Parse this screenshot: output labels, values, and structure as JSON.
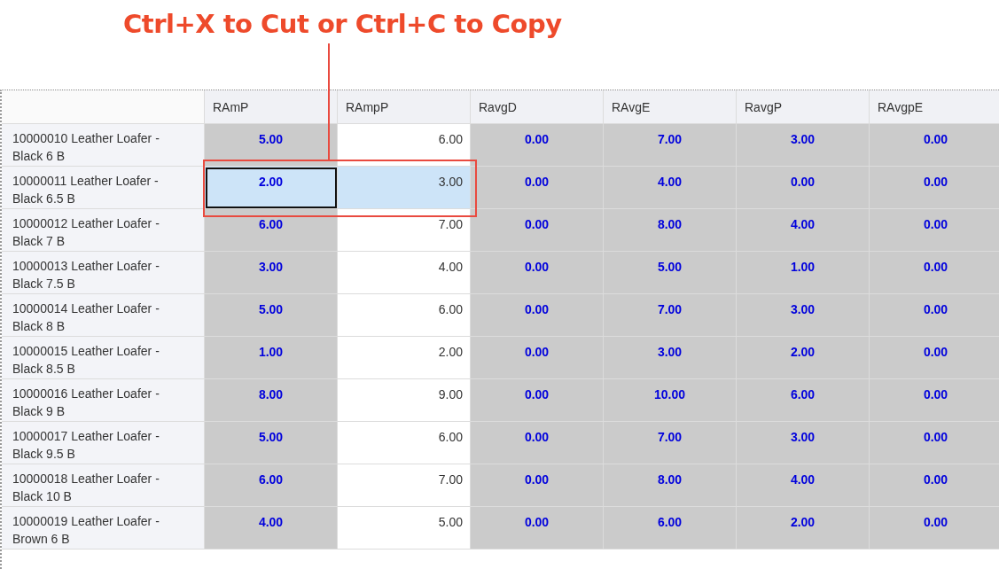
{
  "callout": {
    "text": "Ctrl+X to Cut or Ctrl+C to Copy"
  },
  "table": {
    "columns": [
      {
        "label": "RAmP",
        "kind": "computed"
      },
      {
        "label": "RAmpP",
        "kind": "editable"
      },
      {
        "label": "RavgD",
        "kind": "computed"
      },
      {
        "label": "RAvgE",
        "kind": "computed"
      },
      {
        "label": "RavgP",
        "kind": "computed"
      },
      {
        "label": "RAvgpE",
        "kind": "computed"
      }
    ],
    "rows": [
      {
        "label": "10000010 Leather Loafer - Black 6 B",
        "cells": [
          {
            "value": "5.00",
            "selected": false,
            "focused": false
          },
          {
            "value": "6.00",
            "selected": false,
            "focused": false
          },
          {
            "value": "0.00",
            "selected": false,
            "focused": false
          },
          {
            "value": "7.00",
            "selected": false,
            "focused": false
          },
          {
            "value": "3.00",
            "selected": false,
            "focused": false
          },
          {
            "value": "0.00",
            "selected": false,
            "focused": false
          }
        ]
      },
      {
        "label": "10000011 Leather Loafer - Black 6.5 B",
        "cells": [
          {
            "value": "2.00",
            "selected": true,
            "focused": true
          },
          {
            "value": "3.00",
            "selected": true,
            "focused": false
          },
          {
            "value": "0.00",
            "selected": false,
            "focused": false
          },
          {
            "value": "4.00",
            "selected": false,
            "focused": false
          },
          {
            "value": "0.00",
            "selected": false,
            "focused": false
          },
          {
            "value": "0.00",
            "selected": false,
            "focused": false
          }
        ]
      },
      {
        "label": "10000012 Leather Loafer - Black 7 B",
        "cells": [
          {
            "value": "6.00",
            "selected": false,
            "focused": false
          },
          {
            "value": "7.00",
            "selected": false,
            "focused": false
          },
          {
            "value": "0.00",
            "selected": false,
            "focused": false
          },
          {
            "value": "8.00",
            "selected": false,
            "focused": false
          },
          {
            "value": "4.00",
            "selected": false,
            "focused": false
          },
          {
            "value": "0.00",
            "selected": false,
            "focused": false
          }
        ]
      },
      {
        "label": "10000013 Leather Loafer - Black 7.5 B",
        "cells": [
          {
            "value": "3.00",
            "selected": false,
            "focused": false
          },
          {
            "value": "4.00",
            "selected": false,
            "focused": false
          },
          {
            "value": "0.00",
            "selected": false,
            "focused": false
          },
          {
            "value": "5.00",
            "selected": false,
            "focused": false
          },
          {
            "value": "1.00",
            "selected": false,
            "focused": false
          },
          {
            "value": "0.00",
            "selected": false,
            "focused": false
          }
        ]
      },
      {
        "label": "10000014 Leather Loafer - Black 8 B",
        "cells": [
          {
            "value": "5.00",
            "selected": false,
            "focused": false
          },
          {
            "value": "6.00",
            "selected": false,
            "focused": false
          },
          {
            "value": "0.00",
            "selected": false,
            "focused": false
          },
          {
            "value": "7.00",
            "selected": false,
            "focused": false
          },
          {
            "value": "3.00",
            "selected": false,
            "focused": false
          },
          {
            "value": "0.00",
            "selected": false,
            "focused": false
          }
        ]
      },
      {
        "label": "10000015 Leather Loafer - Black 8.5 B",
        "cells": [
          {
            "value": "1.00",
            "selected": false,
            "focused": false
          },
          {
            "value": "2.00",
            "selected": false,
            "focused": false
          },
          {
            "value": "0.00",
            "selected": false,
            "focused": false
          },
          {
            "value": "3.00",
            "selected": false,
            "focused": false
          },
          {
            "value": "2.00",
            "selected": false,
            "focused": false
          },
          {
            "value": "0.00",
            "selected": false,
            "focused": false
          }
        ]
      },
      {
        "label": "10000016 Leather Loafer - Black 9 B",
        "cells": [
          {
            "value": "8.00",
            "selected": false,
            "focused": false
          },
          {
            "value": "9.00",
            "selected": false,
            "focused": false
          },
          {
            "value": "0.00",
            "selected": false,
            "focused": false
          },
          {
            "value": "10.00",
            "selected": false,
            "focused": false
          },
          {
            "value": "6.00",
            "selected": false,
            "focused": false
          },
          {
            "value": "0.00",
            "selected": false,
            "focused": false
          }
        ]
      },
      {
        "label": "10000017 Leather Loafer - Black 9.5 B",
        "cells": [
          {
            "value": "5.00",
            "selected": false,
            "focused": false
          },
          {
            "value": "6.00",
            "selected": false,
            "focused": false
          },
          {
            "value": "0.00",
            "selected": false,
            "focused": false
          },
          {
            "value": "7.00",
            "selected": false,
            "focused": false
          },
          {
            "value": "3.00",
            "selected": false,
            "focused": false
          },
          {
            "value": "0.00",
            "selected": false,
            "focused": false
          }
        ]
      },
      {
        "label": "10000018 Leather Loafer - Black 10 B",
        "cells": [
          {
            "value": "6.00",
            "selected": false,
            "focused": false
          },
          {
            "value": "7.00",
            "selected": false,
            "focused": false
          },
          {
            "value": "0.00",
            "selected": false,
            "focused": false
          },
          {
            "value": "8.00",
            "selected": false,
            "focused": false
          },
          {
            "value": "4.00",
            "selected": false,
            "focused": false
          },
          {
            "value": "0.00",
            "selected": false,
            "focused": false
          }
        ]
      },
      {
        "label": "10000019 Leather Loafer - Brown 6 B",
        "cells": [
          {
            "value": "4.00",
            "selected": false,
            "focused": false
          },
          {
            "value": "5.00",
            "selected": false,
            "focused": false
          },
          {
            "value": "0.00",
            "selected": false,
            "focused": false
          },
          {
            "value": "6.00",
            "selected": false,
            "focused": false
          },
          {
            "value": "2.00",
            "selected": false,
            "focused": false
          },
          {
            "value": "0.00",
            "selected": false,
            "focused": false
          }
        ]
      }
    ]
  }
}
